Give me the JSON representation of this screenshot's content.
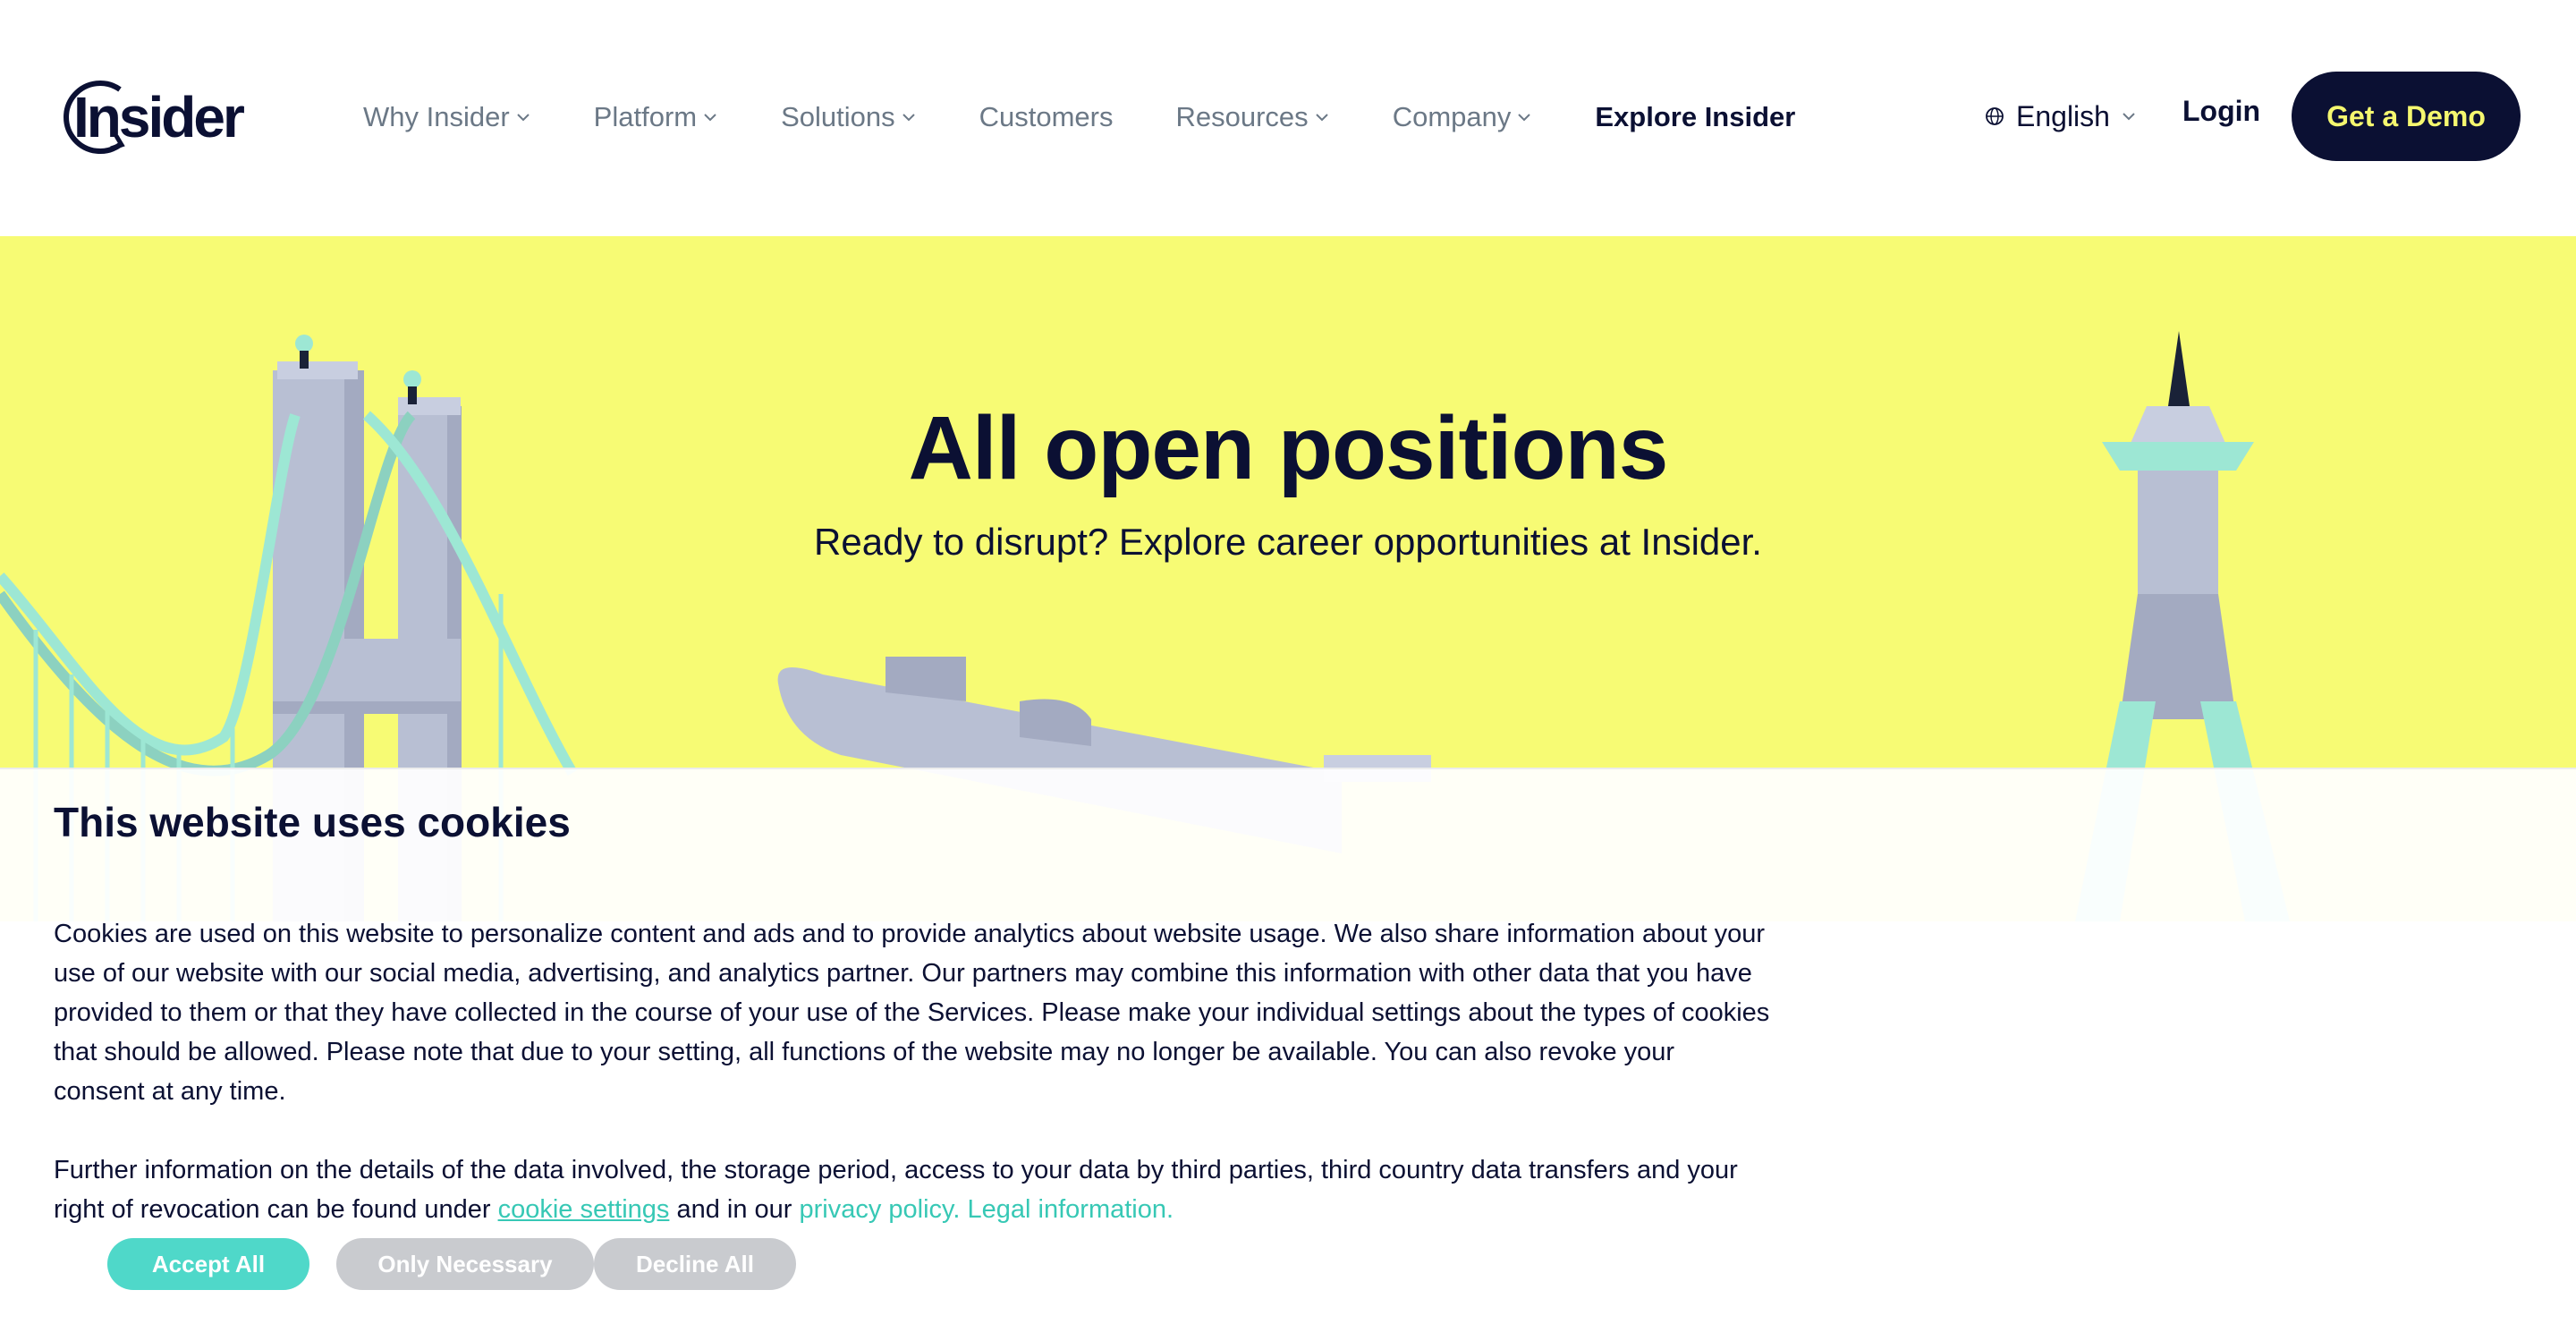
{
  "brand": {
    "logo_text": "Insider"
  },
  "nav": {
    "items": [
      {
        "label": "Why Insider",
        "has_dropdown": true
      },
      {
        "label": "Platform",
        "has_dropdown": true
      },
      {
        "label": "Solutions",
        "has_dropdown": true
      },
      {
        "label": "Customers",
        "has_dropdown": false
      },
      {
        "label": "Resources",
        "has_dropdown": true
      },
      {
        "label": "Company",
        "has_dropdown": true
      },
      {
        "label": "Explore Insider",
        "has_dropdown": false
      }
    ],
    "language": "English",
    "language_icon": "globe-icon",
    "login": "Login",
    "cta": "Get a Demo"
  },
  "hero": {
    "title": "All open positions",
    "subtitle": "Ready to disrupt? Explore career opportunities at Insider."
  },
  "cookie": {
    "title": "This website uses cookies",
    "paragraph1": "Cookies are used on this website to personalize content and ads and to provide analytics about website usage. We also share information about your use of our website with our social media, advertising, and analytics partner. Our partners may combine this information with other data that you have provided to them or that they have collected in the course of your use of the Services. Please make your individual settings about the types of cookies that should be allowed. Please note that due to your setting, all functions of the website may no longer be available. You can also revoke your consent at any time.",
    "paragraph2_prefix": "Further information on the details of the data involved, the storage period, access to your data by third parties, third country data transfers and your right of revocation can be found under ",
    "settings_link": "cookie settings",
    "paragraph2_mid": " and in our ",
    "privacy_link": "privacy policy.",
    "legal_link": "Legal information.",
    "buttons": {
      "accept": "Accept All",
      "necessary": "Only Necessary",
      "decline": "Decline All"
    }
  },
  "colors": {
    "navy": "#0b1033",
    "hero_yellow": "#f7fb74",
    "cta_text": "#f5f76f",
    "accent_teal": "#4fd8c9",
    "nav_grey": "#6b7886",
    "button_grey": "#c9cbcf"
  }
}
